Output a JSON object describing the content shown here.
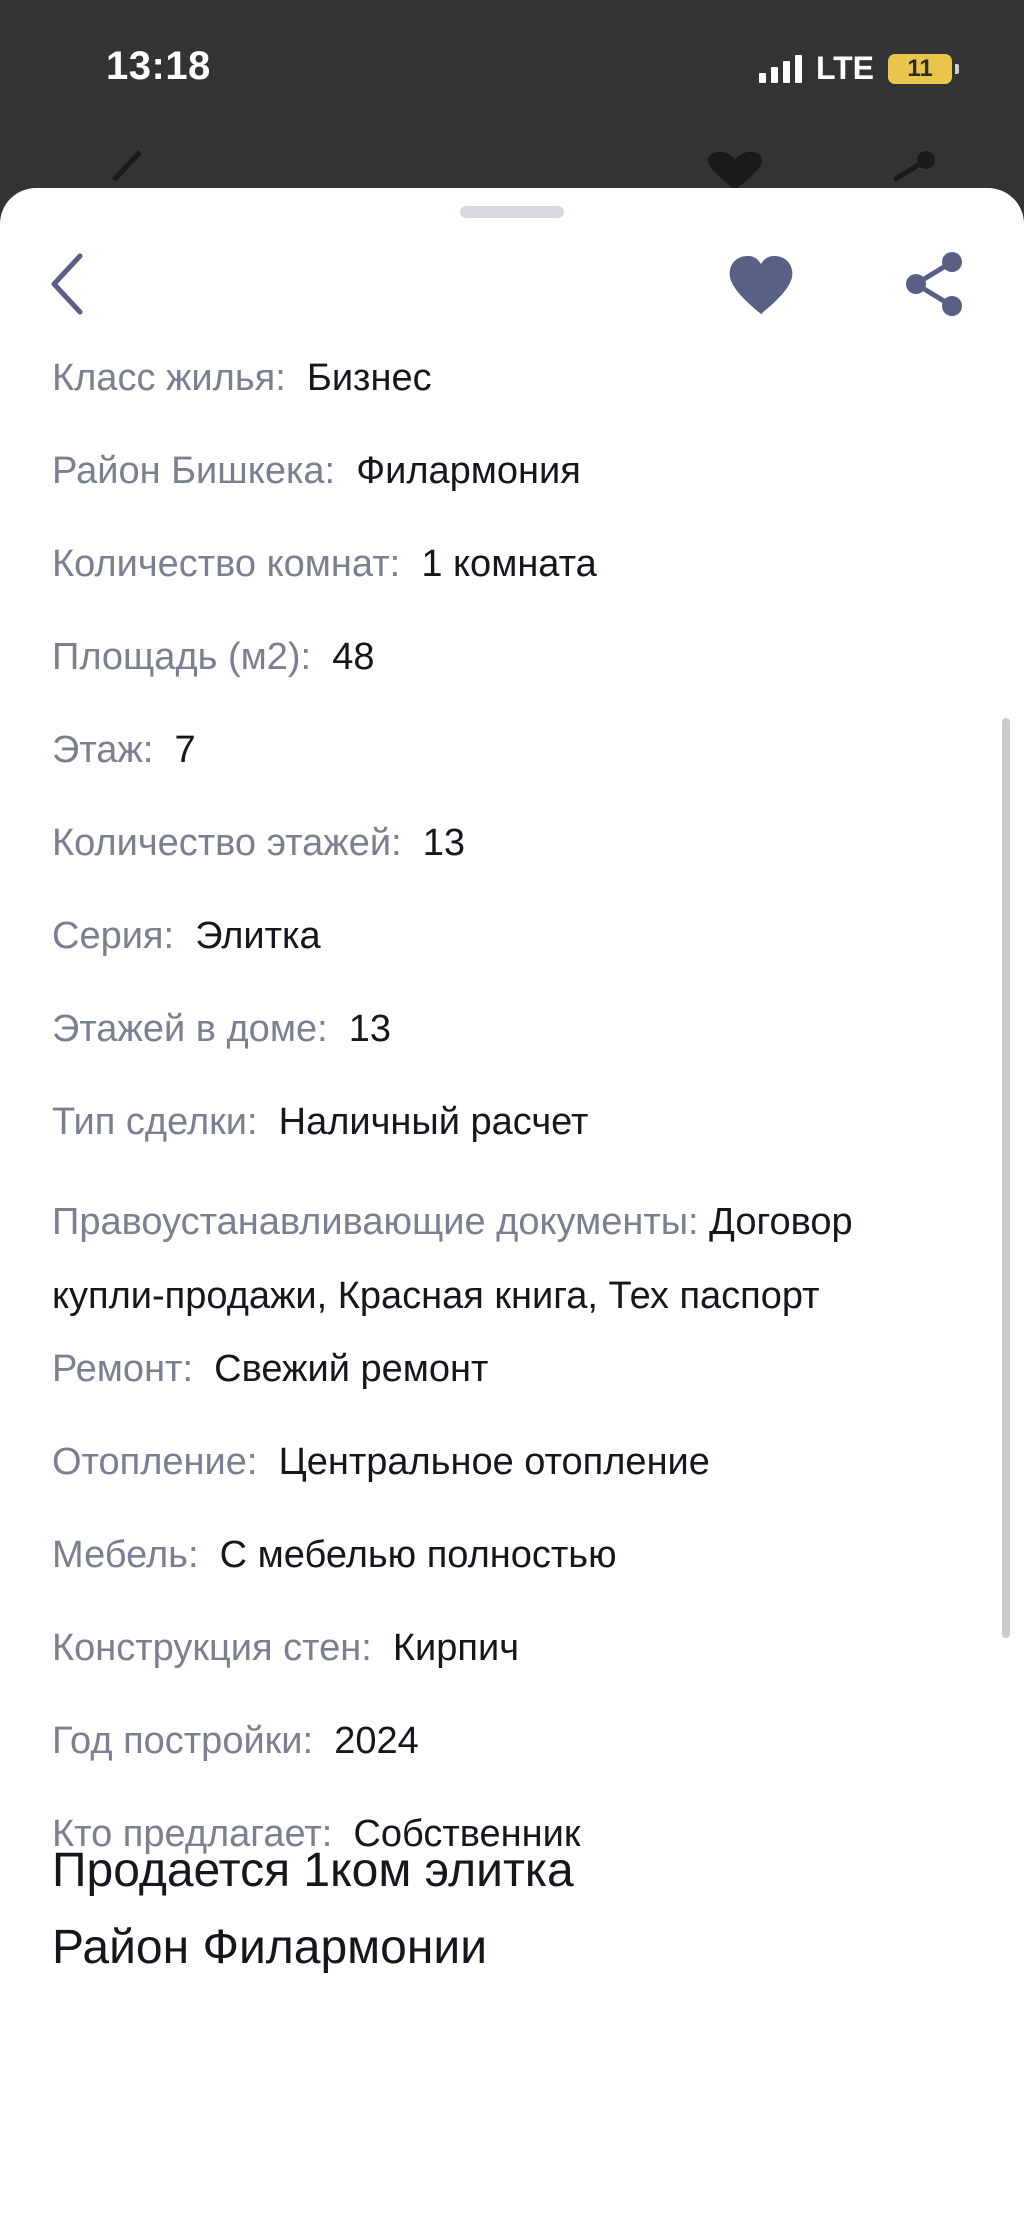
{
  "status_bar": {
    "time": "13:18",
    "network": "LTE",
    "battery": "11",
    "battery_color": "#e9c64b"
  },
  "colors": {
    "accent": "#5a5f86",
    "label": "#7a8092",
    "value": "#15171f"
  },
  "header": {
    "back_icon": "chevron-left-icon",
    "favorite_icon": "heart-icon",
    "share_icon": "share-icon"
  },
  "details": [
    {
      "label": "Класс жилья:",
      "value": "Бизнес"
    },
    {
      "label": "Район Бишкека:",
      "value": "Филармония"
    },
    {
      "label": "Количество комнат:",
      "value": "1 комната"
    },
    {
      "label": "Площадь (м2):",
      "value": "48"
    },
    {
      "label": "Этаж:",
      "value": "7"
    },
    {
      "label": "Количество этажей:",
      "value": "13"
    },
    {
      "label": "Серия:",
      "value": "Элитка"
    },
    {
      "label": "Этажей в доме:",
      "value": "13"
    },
    {
      "label": "Тип сделки:",
      "value": "Наличный расчет"
    },
    {
      "label": "Правоустанавливающие документы:",
      "value": "Договор купли-продажи, Красная книга, Тех паспорт"
    },
    {
      "label": "Ремонт:",
      "value": "Свежий ремонт"
    },
    {
      "label": "Отопление:",
      "value": "Центральное отопление"
    },
    {
      "label": "Мебель:",
      "value": "С мебелью полностью"
    },
    {
      "label": "Конструкция стен:",
      "value": "Кирпич"
    },
    {
      "label": "Год постройки:",
      "value": "2024"
    },
    {
      "label": "Кто предлагает:",
      "value": "Собственник"
    }
  ],
  "description": {
    "line1": "Продается 1ком элитка",
    "line2": "Район Филармонии"
  }
}
